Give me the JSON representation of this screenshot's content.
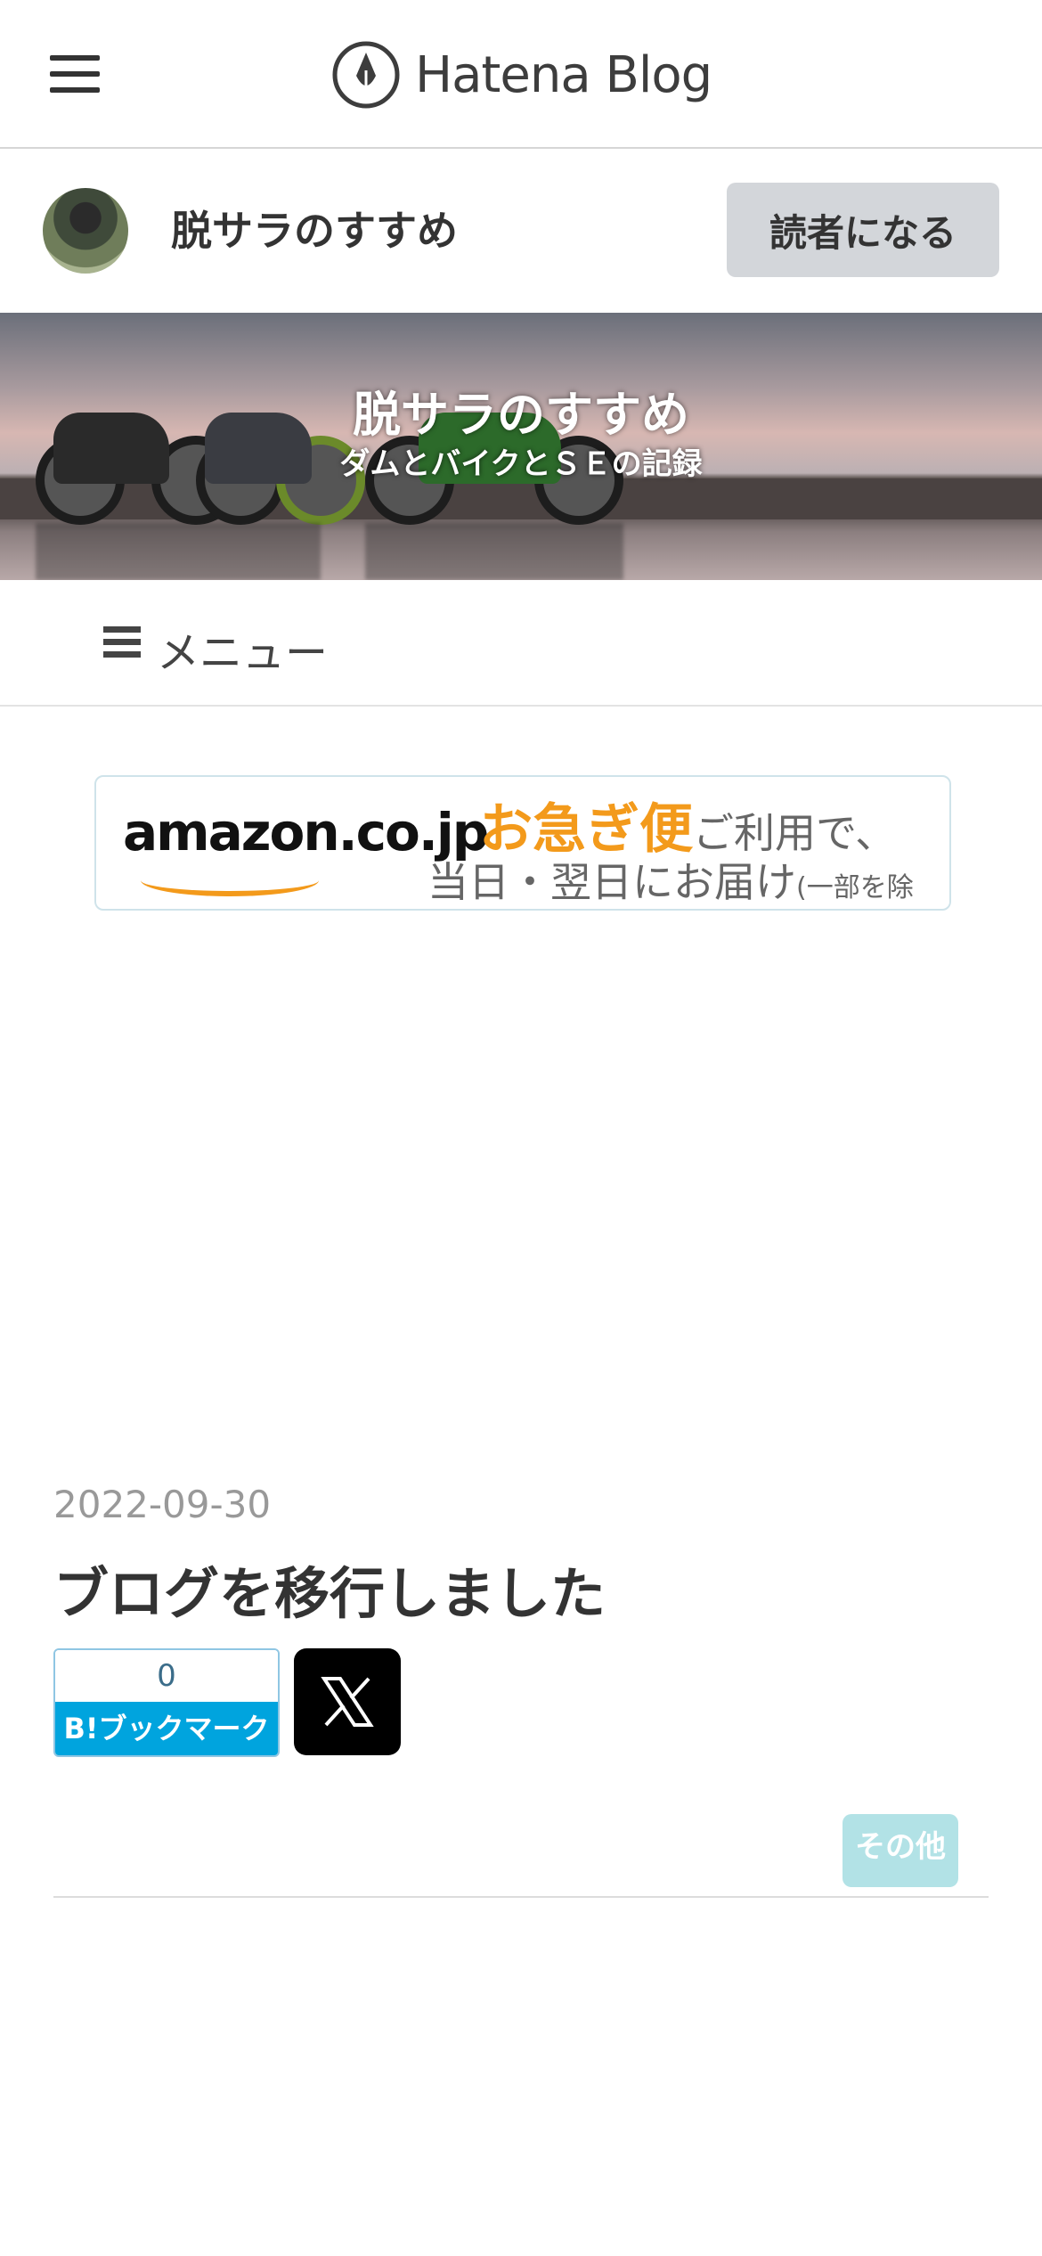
{
  "header": {
    "logo_text": "Hatena Blog"
  },
  "blog": {
    "name": "脱サラのすすめ",
    "subscribe_label": "読者になる"
  },
  "hero": {
    "title": "脱サラのすすめ",
    "subtitle": "ダムとバイクとＳＥの記録"
  },
  "menu": {
    "label": "メニュー"
  },
  "ad": {
    "brand": "amazon.co.jp",
    "headline": "お急ぎ便",
    "headline_rest": "ご利用で、",
    "line2": "当日・翌日にお届け",
    "line2_note": "(一部を除く)"
  },
  "post": {
    "date": "2022-09-30",
    "title": "ブログを移行しました",
    "bookmark_count": "0",
    "bookmark_label": "B!ブックマーク",
    "category": "その他"
  },
  "colors": {
    "bookmark_blue": "#00a4de",
    "category_tag": "#b2e2e6",
    "amazon_orange": "#f39a1b"
  }
}
